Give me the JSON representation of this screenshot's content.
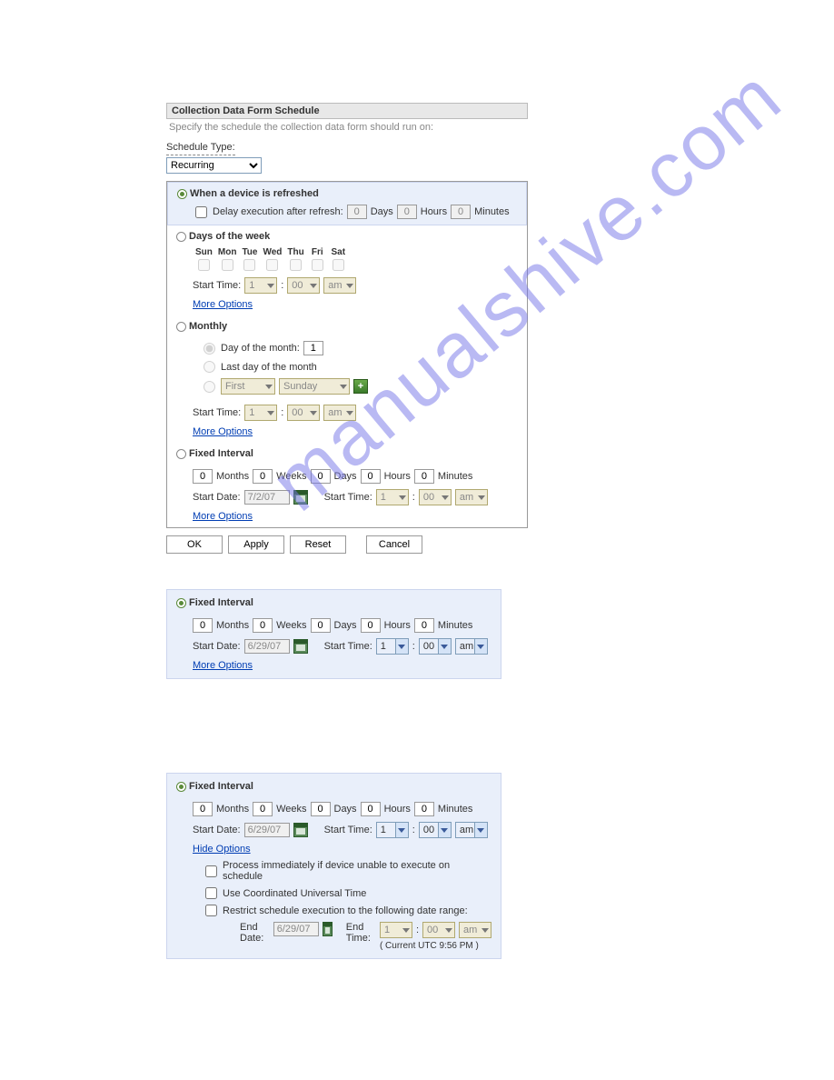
{
  "header": {
    "title": "Collection Data Form Schedule",
    "description": "Specify the schedule the collection data form should run on:"
  },
  "schedule_type": {
    "label": "Schedule Type:",
    "value": "Recurring"
  },
  "option_refresh": {
    "label": "When a device is refreshed",
    "delay_label": "Delay execution after refresh:",
    "days_val": "0",
    "days_lbl": "Days",
    "hours_val": "0",
    "hours_lbl": "Hours",
    "minutes_val": "0",
    "minutes_lbl": "Minutes"
  },
  "option_weekly": {
    "label": "Days of the week",
    "days": [
      "Sun",
      "Mon",
      "Tue",
      "Wed",
      "Thu",
      "Fri",
      "Sat"
    ],
    "start_time_lbl": "Start Time:",
    "hour": "1",
    "minute": "00",
    "ampm": "am",
    "more_options": "More Options"
  },
  "option_monthly": {
    "label": "Monthly",
    "day_of_month_lbl": "Day of the month:",
    "day_of_month_val": "1",
    "last_day_lbl": "Last day of the month",
    "ordinal": "First",
    "weekday": "Sunday",
    "start_time_lbl": "Start Time:",
    "hour": "1",
    "minute": "00",
    "ampm": "am",
    "more_options": "More Options"
  },
  "option_fixed": {
    "label": "Fixed Interval",
    "months_val": "0",
    "months_lbl": "Months",
    "weeks_val": "0",
    "weeks_lbl": "Weeks",
    "days_val": "0",
    "days_lbl": "Days",
    "hours_val": "0",
    "hours_lbl": "Hours",
    "minutes_val": "0",
    "minutes_lbl": "Minutes",
    "start_date_lbl": "Start Date:",
    "start_date_val": "7/2/07",
    "start_time_lbl": "Start Time:",
    "hour": "1",
    "minute": "00",
    "ampm": "am",
    "more_options": "More Options"
  },
  "buttons": {
    "ok": "OK",
    "apply": "Apply",
    "reset": "Reset",
    "cancel": "Cancel"
  },
  "panel2": {
    "label": "Fixed Interval",
    "months_val": "0",
    "months_lbl": "Months",
    "weeks_val": "0",
    "weeks_lbl": "Weeks",
    "days_val": "0",
    "days_lbl": "Days",
    "hours_val": "0",
    "hours_lbl": "Hours",
    "minutes_val": "0",
    "minutes_lbl": "Minutes",
    "start_date_lbl": "Start Date:",
    "start_date_val": "6/29/07",
    "start_time_lbl": "Start Time:",
    "hour": "1",
    "minute": "00",
    "ampm": "am",
    "more_options": "More Options"
  },
  "panel3": {
    "label": "Fixed Interval",
    "months_val": "0",
    "months_lbl": "Months",
    "weeks_val": "0",
    "weeks_lbl": "Weeks",
    "days_val": "0",
    "days_lbl": "Days",
    "hours_val": "0",
    "hours_lbl": "Hours",
    "minutes_val": "0",
    "minutes_lbl": "Minutes",
    "start_date_lbl": "Start Date:",
    "start_date_val": "6/29/07",
    "start_time_lbl": "Start Time:",
    "hour": "1",
    "minute": "00",
    "ampm": "am",
    "hide_options": "Hide Options",
    "opt1": "Process immediately if device unable to execute on schedule",
    "opt2": "Use Coordinated Universal Time",
    "opt3": "Restrict schedule execution to the following date range:",
    "end_date_lbl": "End Date:",
    "end_date_val": "6/29/07",
    "end_time_lbl": "End Time:",
    "end_hour": "1",
    "end_minute": "00",
    "end_ampm": "am",
    "current_utc": "( Current UTC 9:56 PM )"
  },
  "watermark": "manualshive.com"
}
